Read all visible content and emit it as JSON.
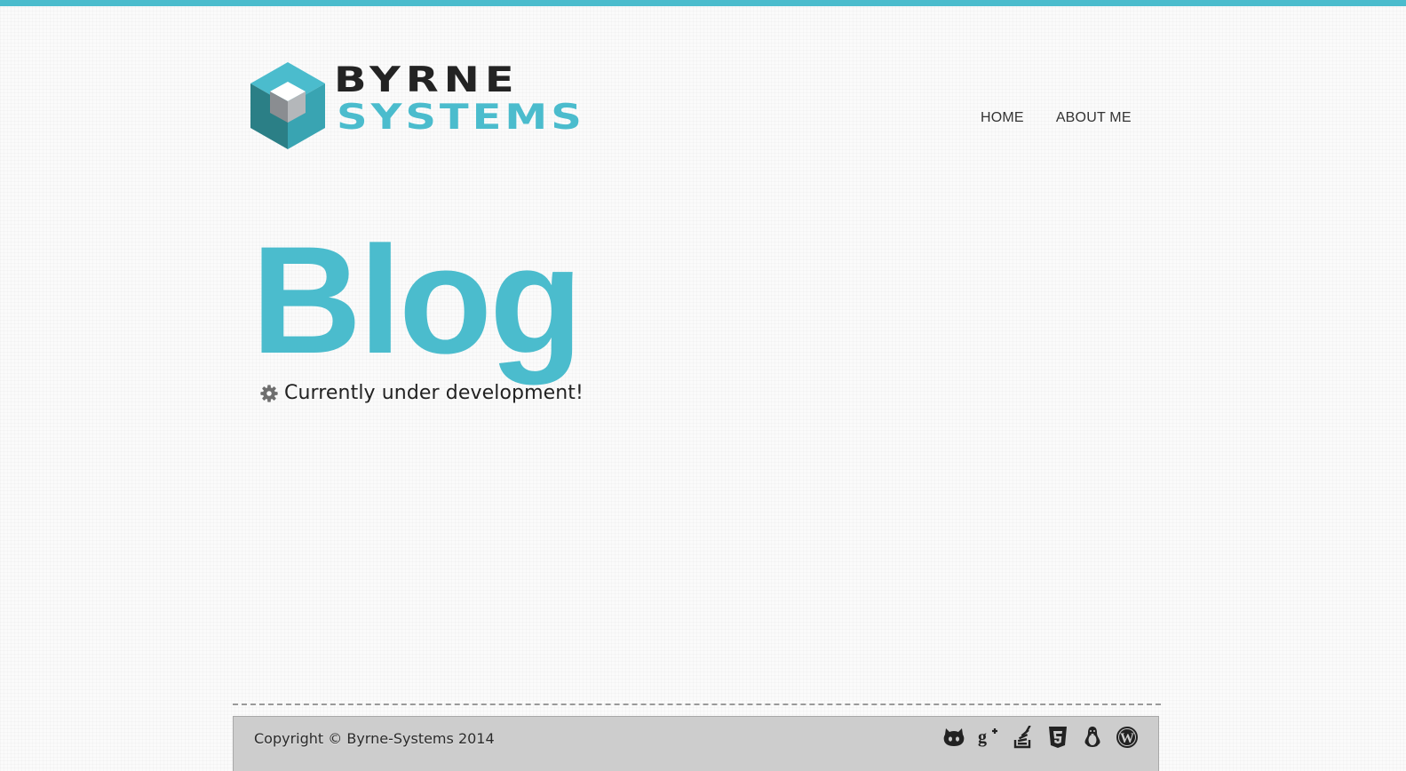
{
  "header": {
    "brand_line_1": "BYRNE",
    "brand_line_2": "SYSTEMS",
    "nav": [
      {
        "label": "HOME"
      },
      {
        "label": "ABOUT ME"
      }
    ]
  },
  "main": {
    "title": "Blog",
    "status_text": "Currently under development!",
    "status_icon": "gear-icon"
  },
  "footer": {
    "copyright": "Copyright © Byrne-Systems 2014",
    "social_icons": [
      "github-icon",
      "google-plus-icon",
      "stack-overflow-icon",
      "html5-icon",
      "linux-icon",
      "wordpress-icon"
    ]
  },
  "colors": {
    "accent": "#4bbccd",
    "logo_dark": "#232323",
    "footer_bg": "#cdcdcd",
    "text": "#222222"
  }
}
